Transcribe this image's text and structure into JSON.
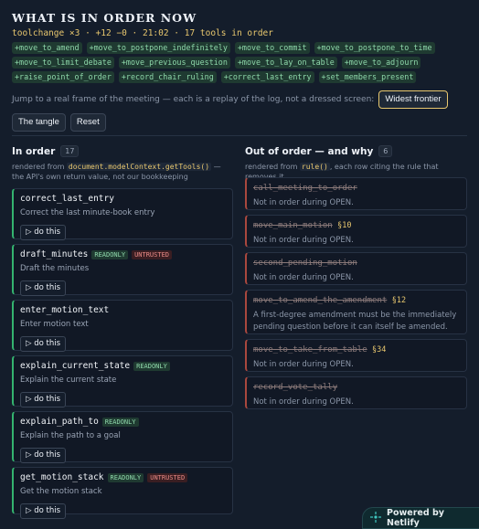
{
  "header": {
    "title": "WHAT IS IN ORDER NOW",
    "meta": "toolchange ×3 · +12 −0 · 21:02 · 17 tools in order",
    "chips": [
      "+move_to_amend",
      "+move_to_postpone_indefinitely",
      "+move_to_commit",
      "+move_to_postpone_to_time",
      "+move_to_limit_debate",
      "+move_previous_question",
      "+move_to_lay_on_table",
      "+move_to_adjourn",
      "+raise_point_of_order",
      "+record_chair_ruling",
      "+correct_last_entry",
      "+set_members_present"
    ],
    "jump_text": "Jump to a real frame of the meeting — each is a replay of the log, not a dressed screen:",
    "buttons": {
      "widest": "Widest frontier",
      "tangle": "The tangle",
      "reset": "Reset"
    }
  },
  "left": {
    "heading": "In order",
    "count": "17",
    "sub_pre": "rendered from ",
    "sub_code": "document.modelContext.getTools()",
    "sub_post": " — the API's own return value, not our bookkeeping",
    "do_label": "▷ do this",
    "cards": [
      {
        "name": "correct_last_entry",
        "desc": "Correct the last minute-book entry",
        "badges": []
      },
      {
        "name": "draft_minutes",
        "desc": "Draft the minutes",
        "badges": [
          "READONLY",
          "UNTRUSTED"
        ]
      },
      {
        "name": "enter_motion_text",
        "desc": "Enter motion text",
        "badges": []
      },
      {
        "name": "explain_current_state",
        "desc": "Explain the current state",
        "badges": [
          "READONLY"
        ]
      },
      {
        "name": "explain_path_to",
        "desc": "Explain the path to a goal",
        "badges": [
          "READONLY"
        ]
      },
      {
        "name": "get_motion_stack",
        "desc": "Get the motion stack",
        "badges": [
          "READONLY",
          "UNTRUSTED"
        ]
      }
    ]
  },
  "right": {
    "heading": "Out of order — and why",
    "count": "6",
    "sub_pre": "rendered from ",
    "sub_code": "rule()",
    "sub_post": ", each row citing the rule that removes it",
    "cards": [
      {
        "name": "call_meeting_to_order",
        "rule": "",
        "desc": "Not in order during OPEN."
      },
      {
        "name": "move_main_motion",
        "rule": "§10",
        "desc": "Not in order during OPEN."
      },
      {
        "name": "second_pending_motion",
        "rule": "",
        "desc": "Not in order during OPEN."
      },
      {
        "name": "move_to_amend_the_amendment",
        "rule": "§12",
        "desc": "A first-degree amendment must be the immediately pending question before it can itself be amended."
      },
      {
        "name": "move_to_take_from_table",
        "rule": "§34",
        "desc": "Not in order during OPEN."
      },
      {
        "name": "record_vote_tally",
        "rule": "",
        "desc": "Not in order during OPEN."
      }
    ]
  },
  "footer": {
    "netlify": "Powered by Netlify"
  },
  "colors": {
    "bg": "#141d2b",
    "accent": "#e8c76e",
    "green": "#34b36f",
    "red": "#a8473e"
  }
}
